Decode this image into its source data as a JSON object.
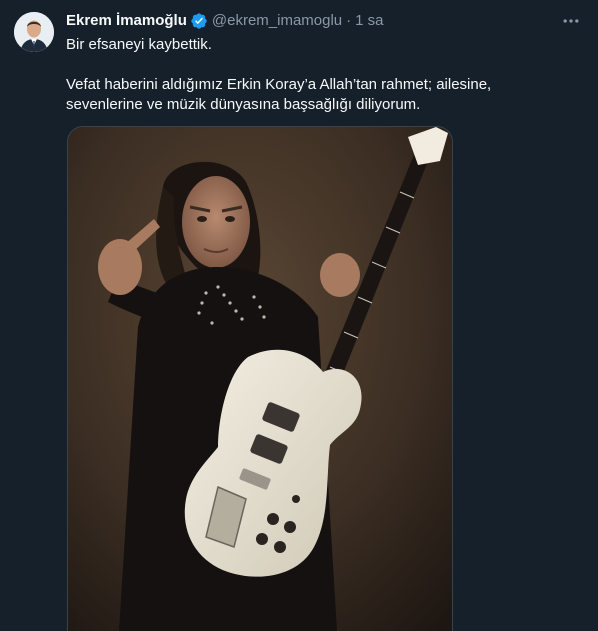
{
  "tweet": {
    "author": {
      "display_name": "Ekrem İmamoğlu",
      "handle": "@ekrem_imamoglu",
      "verified": true,
      "avatar_icon": "profile-photo"
    },
    "separator": "·",
    "time": "1 sa",
    "text_line1": "Bir efsaneyi kaybettik.",
    "text_line2": "Vefat haberini aldığımız Erkin Koray’a Allah’tan rahmet; ailesine,",
    "text_line3": "sevenlerine ve müzik dünyasına başsağlığı diliyorum.",
    "more_icon": "more-horizontal-icon",
    "media": {
      "type": "image",
      "subject": "man-with-white-guitar-pointing"
    }
  },
  "colors": {
    "background": "#15202b",
    "text_primary": "#f7f9f9",
    "text_secondary": "#8b98a5",
    "verified_blue": "#1d9bf0",
    "border": "#38444d"
  }
}
